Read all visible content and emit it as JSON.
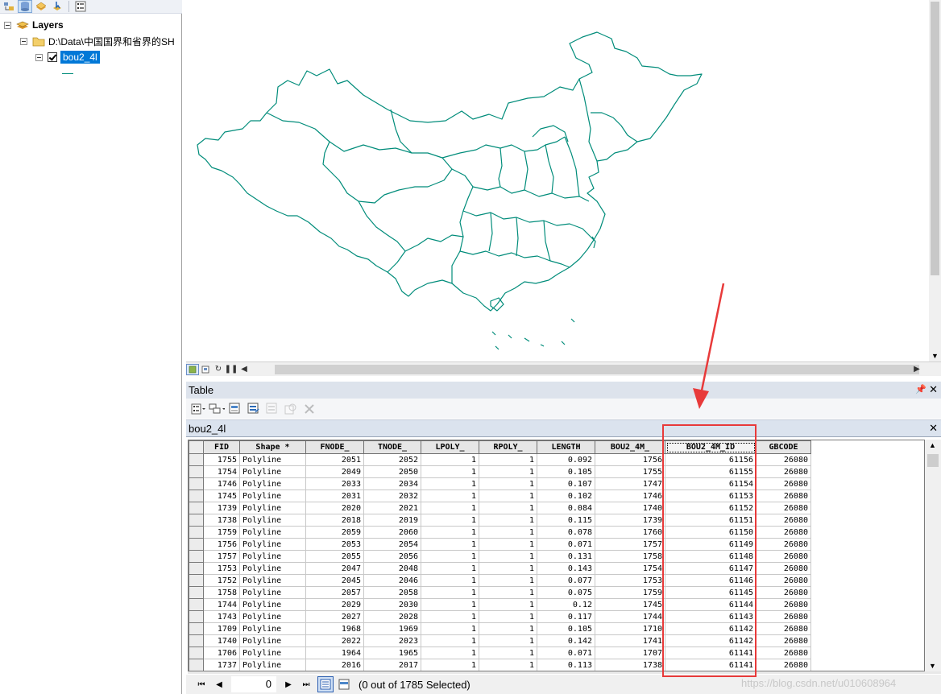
{
  "toc": {
    "layers_label": "Layers",
    "folder_label": "D:\\Data\\中国国界和省界的SH",
    "layer_label": "bou2_4l"
  },
  "map": {
    "line_color": "#008c7a"
  },
  "table_window": {
    "title": "Table",
    "tab_label": "bou2_4l",
    "columns": [
      "FID",
      "Shape *",
      "FNODE_",
      "TNODE_",
      "LPOLY_",
      "RPOLY_",
      "LENGTH",
      "BOU2_4M_",
      "BOU2_4M_ID",
      "GBCODE"
    ],
    "rows": [
      [
        "1755",
        "Polyline",
        "2051",
        "2052",
        "1",
        "1",
        "0.092",
        "1756",
        "61156",
        "26080"
      ],
      [
        "1754",
        "Polyline",
        "2049",
        "2050",
        "1",
        "1",
        "0.105",
        "1755",
        "61155",
        "26080"
      ],
      [
        "1746",
        "Polyline",
        "2033",
        "2034",
        "1",
        "1",
        "0.107",
        "1747",
        "61154",
        "26080"
      ],
      [
        "1745",
        "Polyline",
        "2031",
        "2032",
        "1",
        "1",
        "0.102",
        "1746",
        "61153",
        "26080"
      ],
      [
        "1739",
        "Polyline",
        "2020",
        "2021",
        "1",
        "1",
        "0.084",
        "1740",
        "61152",
        "26080"
      ],
      [
        "1738",
        "Polyline",
        "2018",
        "2019",
        "1",
        "1",
        "0.115",
        "1739",
        "61151",
        "26080"
      ],
      [
        "1759",
        "Polyline",
        "2059",
        "2060",
        "1",
        "1",
        "0.078",
        "1760",
        "61150",
        "26080"
      ],
      [
        "1756",
        "Polyline",
        "2053",
        "2054",
        "1",
        "1",
        "0.071",
        "1757",
        "61149",
        "26080"
      ],
      [
        "1757",
        "Polyline",
        "2055",
        "2056",
        "1",
        "1",
        "0.131",
        "1758",
        "61148",
        "26080"
      ],
      [
        "1753",
        "Polyline",
        "2047",
        "2048",
        "1",
        "1",
        "0.143",
        "1754",
        "61147",
        "26080"
      ],
      [
        "1752",
        "Polyline",
        "2045",
        "2046",
        "1",
        "1",
        "0.077",
        "1753",
        "61146",
        "26080"
      ],
      [
        "1758",
        "Polyline",
        "2057",
        "2058",
        "1",
        "1",
        "0.075",
        "1759",
        "61145",
        "26080"
      ],
      [
        "1744",
        "Polyline",
        "2029",
        "2030",
        "1",
        "1",
        "0.12",
        "1745",
        "61144",
        "26080"
      ],
      [
        "1743",
        "Polyline",
        "2027",
        "2028",
        "1",
        "1",
        "0.117",
        "1744",
        "61143",
        "26080"
      ],
      [
        "1709",
        "Polyline",
        "1968",
        "1969",
        "1",
        "1",
        "0.105",
        "1710",
        "61142",
        "26080"
      ],
      [
        "1740",
        "Polyline",
        "2022",
        "2023",
        "1",
        "1",
        "0.142",
        "1741",
        "61142",
        "26080"
      ],
      [
        "1706",
        "Polyline",
        "1964",
        "1965",
        "1",
        "1",
        "0.071",
        "1707",
        "61141",
        "26080"
      ],
      [
        "1737",
        "Polyline",
        "2016",
        "2017",
        "1",
        "1",
        "0.113",
        "1738",
        "61141",
        "26080"
      ]
    ],
    "record_value": "0",
    "selection_status": "(0 out of 1785 Selected)"
  },
  "watermark": "https://blog.csdn.net/u010608964",
  "colors": {
    "highlight_box": "#e83a3a",
    "selected_layer": "#0078d7"
  }
}
